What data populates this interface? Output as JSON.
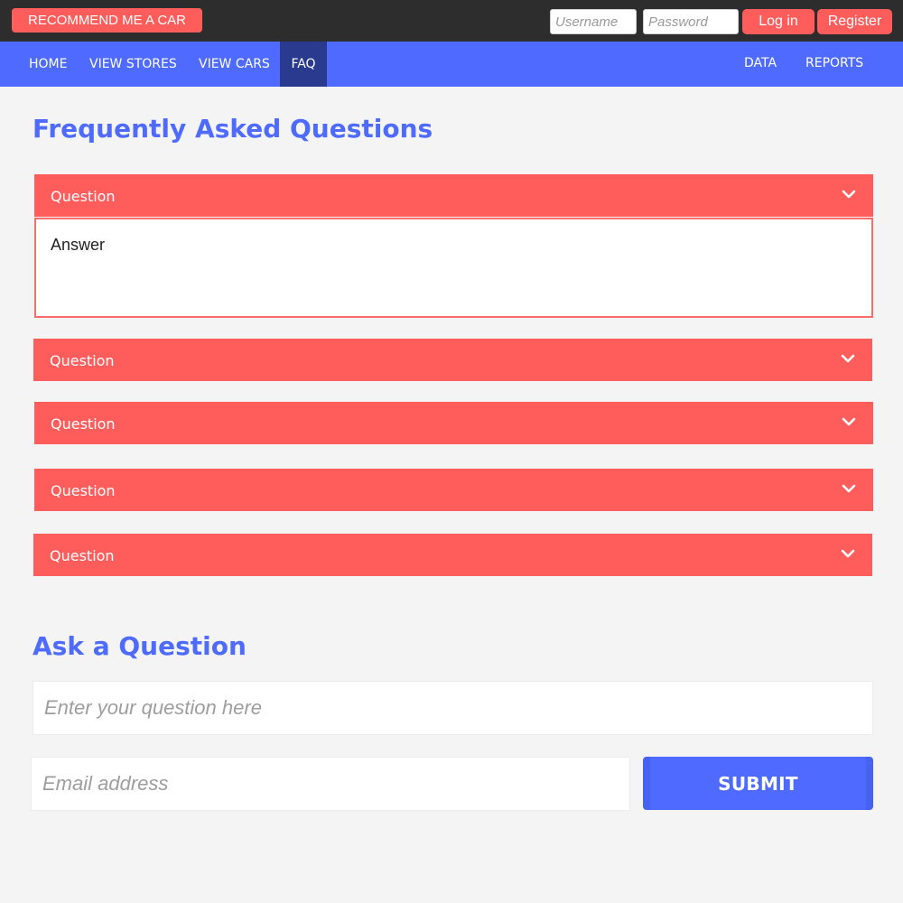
{
  "topbar": {
    "recommend_label": "RECOMMEND ME A CAR",
    "username_placeholder": "Username",
    "password_placeholder": "Password",
    "login_label": "Log in",
    "register_label": "Register"
  },
  "nav": {
    "left_items": [
      "HOME",
      "VIEW STORES",
      "VIEW CARS",
      "FAQ"
    ],
    "right_items": [
      "DATA",
      "REPORTS"
    ],
    "active": "FAQ"
  },
  "faq": {
    "title": "Frequently Asked Questions",
    "items": [
      {
        "question": "Question",
        "answer": "Answer",
        "expanded": true
      },
      {
        "question": "Question",
        "expanded": false
      },
      {
        "question": "Question",
        "expanded": false
      },
      {
        "question": "Question",
        "expanded": false
      },
      {
        "question": "Question",
        "expanded": false
      }
    ]
  },
  "ask": {
    "title": "Ask a Question",
    "question_placeholder": "Enter your question here",
    "email_placeholder": "Email address",
    "submit_label": "SUBMIT"
  },
  "colors": {
    "topbar_bg": "#2d2d2d",
    "accent_red": "#ff5c5c",
    "nav_blue": "#4f6bff",
    "nav_active": "#2a3b8f",
    "page_bg": "#f4f4f4"
  },
  "icons": {
    "accordion_toggle": "chevron-down-icon"
  }
}
